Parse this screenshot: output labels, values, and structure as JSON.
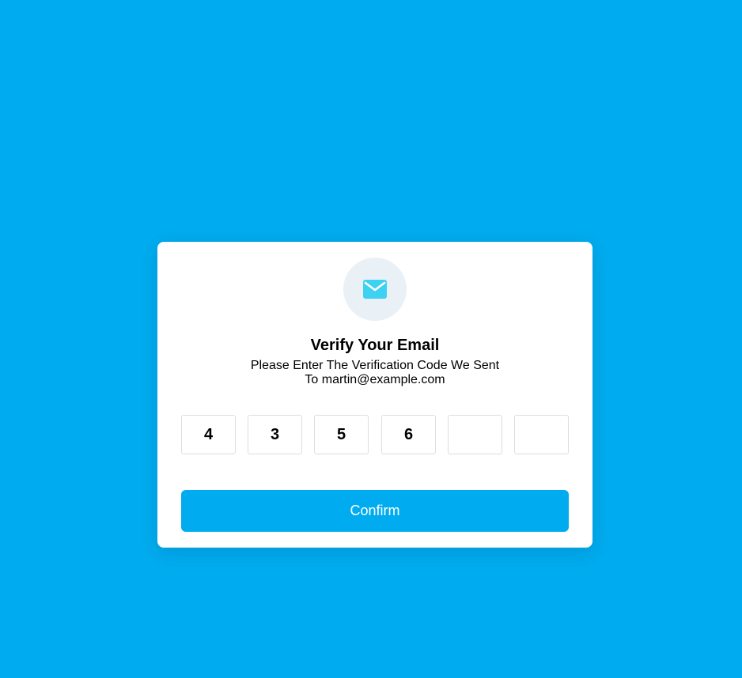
{
  "colors": {
    "background": "#00acef",
    "card": "#ffffff",
    "icon_circle": "#e9f0f6",
    "icon": "#3fd1f2",
    "button": "#00acef",
    "button_text": "#ffffff"
  },
  "header": {
    "icon": "mail-icon",
    "title": "Verify Your Email",
    "subtitle_line1": "Please Enter The Verification Code We Sent",
    "subtitle_line2": "To martin@example.com"
  },
  "code": {
    "digits": [
      "4",
      "3",
      "5",
      "6",
      "",
      ""
    ]
  },
  "actions": {
    "confirm_label": "Confirm"
  }
}
